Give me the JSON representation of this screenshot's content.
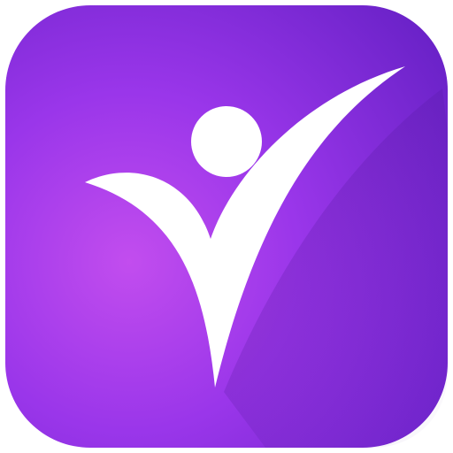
{
  "icon": {
    "name": "person-checkmark-logo-icon",
    "colors": {
      "gradient_light": "#c24dee",
      "gradient_mid": "#9a36ea",
      "gradient_dark": "#6a22c8",
      "figure": "#ffffff",
      "shadow": "#4a1490"
    }
  }
}
